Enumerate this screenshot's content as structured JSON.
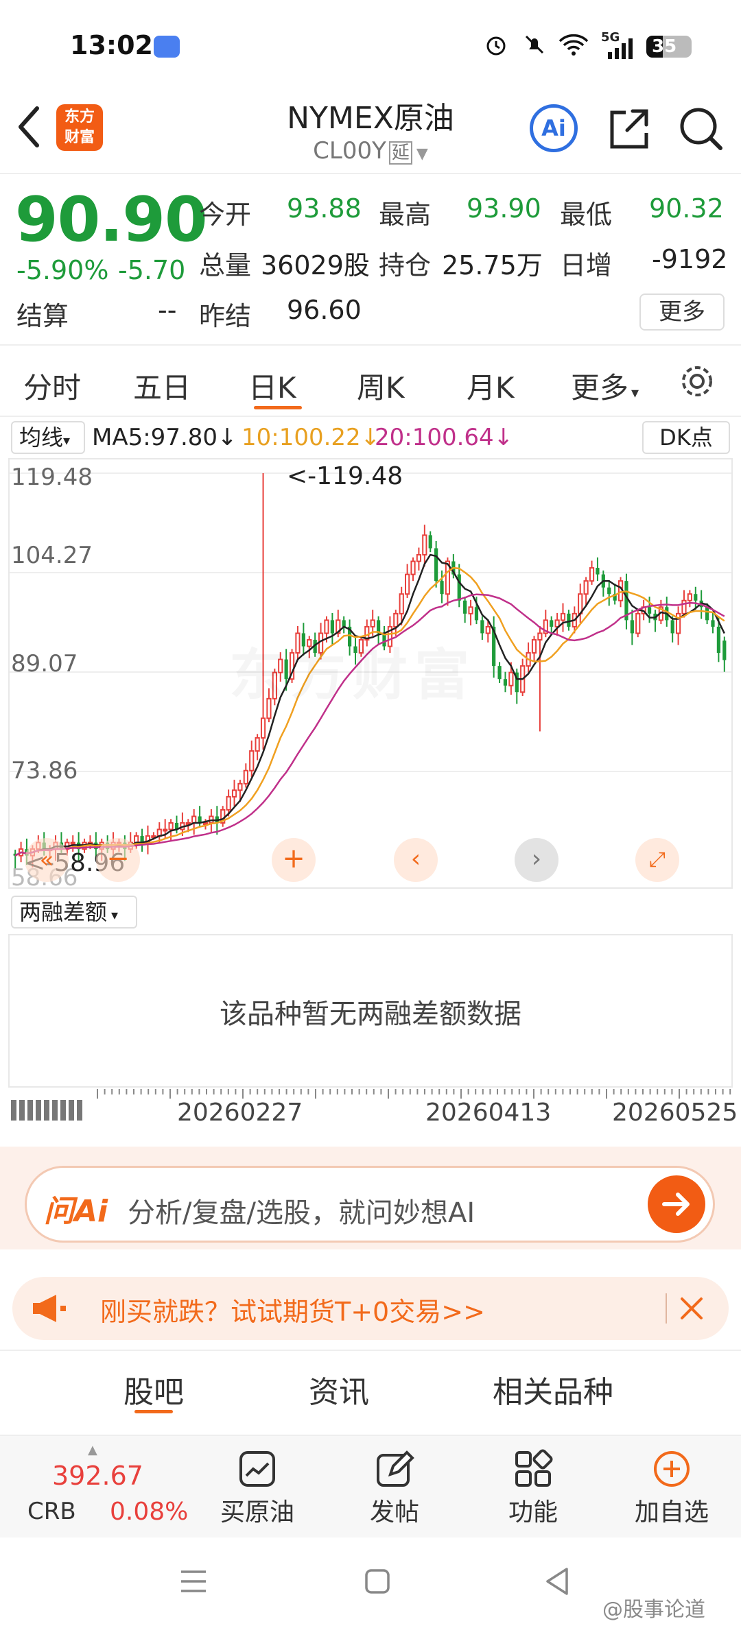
{
  "status": {
    "time": "13:02",
    "network": "5G",
    "battery": "35"
  },
  "header": {
    "title": "NYMEX原油",
    "code": "CL00Y",
    "delay_tag": "延",
    "logo_line1": "东方",
    "logo_line2": "财富",
    "ai_label": "Ai"
  },
  "quote": {
    "price": "90.90",
    "pct": "-5.90%",
    "change": "-5.70",
    "open_label": "今开",
    "open": "93.88",
    "high_label": "最高",
    "high": "93.90",
    "low_label": "最低",
    "low": "90.32",
    "volume_label": "总量",
    "volume": "36029股",
    "oi_label": "持仓",
    "oi": "25.75万",
    "daily_inc_label": "日增",
    "daily_inc": "-9192",
    "settle_label": "结算",
    "settle": "--",
    "prev_settle_label": "昨结",
    "prev_settle": "96.60",
    "more": "更多"
  },
  "period_tabs": [
    "分时",
    "五日",
    "日K",
    "周K",
    "月K",
    "更多"
  ],
  "active_period": "日K",
  "ma_legend": {
    "selector": "均线",
    "ma5": "MA5:97.80↓",
    "ma10": "10:100.22↓",
    "ma20": "20:100.64↓",
    "dk": "DK点"
  },
  "colors": {
    "up": "#e8403c",
    "down": "#1e9b3a",
    "ma5": "#222222",
    "ma10": "#f0a020",
    "ma20": "#c0308a",
    "accent": "#f26a1b"
  },
  "chart_data": {
    "type": "candlestick",
    "y_ticks": [
      "119.48",
      "104.27",
      "89.07",
      "73.86",
      "58.66"
    ],
    "ylim": [
      58.66,
      119.48
    ],
    "annotations": {
      "max": "<-119.48",
      "min": "<-58.96"
    },
    "overlay_icons": [
      "collapse-icon",
      "zoom-out-icon",
      "zoom-in-icon",
      "prev-icon",
      "next-icon",
      "fullscreen-icon"
    ],
    "x_labels": [
      "20260227",
      "20260413",
      "20260525"
    ],
    "close": [
      61,
      62,
      61,
      62,
      63,
      62,
      62,
      63,
      62,
      63,
      63,
      62,
      63,
      63,
      62,
      63,
      62,
      63,
      63,
      62,
      63,
      64,
      63,
      64,
      64,
      65,
      65,
      66,
      65,
      66,
      66,
      67,
      66,
      66,
      67,
      66,
      68,
      70,
      71,
      72,
      74,
      77,
      79,
      82,
      85,
      89,
      91,
      88,
      92,
      95,
      93,
      94,
      92,
      95,
      97,
      95,
      97,
      96,
      93,
      92,
      94,
      96,
      97,
      95,
      93,
      96,
      98,
      101,
      104,
      106,
      107,
      110,
      108,
      103,
      101,
      106,
      104,
      100,
      98,
      99,
      97,
      95,
      96,
      90,
      88,
      87,
      89,
      86,
      90,
      92,
      94,
      95,
      97,
      96,
      97,
      98,
      96,
      98,
      101,
      103,
      105,
      104,
      102,
      101,
      100,
      103,
      97,
      95,
      98,
      99,
      98,
      97,
      99,
      97,
      95,
      98,
      100,
      101,
      100,
      99,
      97,
      96,
      92,
      90.9
    ],
    "ma_note": "MA5/MA10/MA20 lines computed from close"
  },
  "margin": {
    "selector": "两融差额",
    "empty_msg": "该品种暂无两融差额数据"
  },
  "ai_bar": {
    "brand": "问Ai",
    "placeholder": "分析/复盘/选股，就问妙想AI"
  },
  "promo": {
    "text": "刚买就跌？试试期货T+0交易>>"
  },
  "bottom_tabs": [
    "股吧",
    "资讯",
    "相关品种"
  ],
  "active_bottom_tab": "股吧",
  "nav": {
    "crb_value": "392.67",
    "crb_label": "CRB",
    "crb_pct": "0.08%",
    "buy": "买原油",
    "post": "发帖",
    "func": "功能",
    "watch": "加自选"
  },
  "watermark": "@股事论道"
}
